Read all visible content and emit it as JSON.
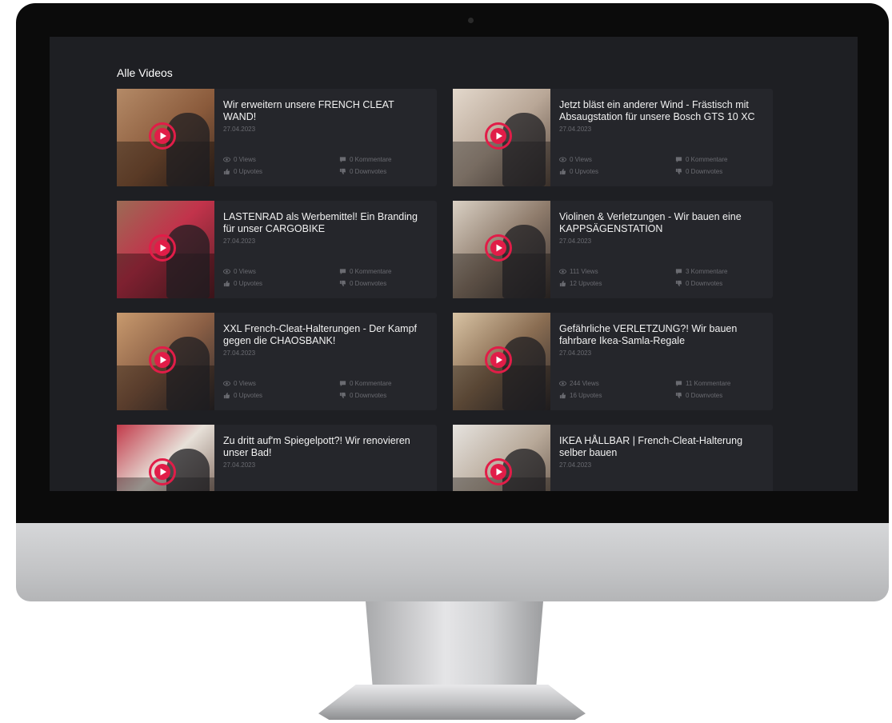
{
  "section_title": "Alle Videos",
  "colors": {
    "accent": "#e11d48",
    "screen_bg": "#1e1f23",
    "card_bg": "#25262b",
    "muted_text": "#6a6b71"
  },
  "icons": {
    "views": "eye-icon",
    "comments": "comment-icon",
    "upvotes": "thumbs-up-icon",
    "downvotes": "thumbs-down-icon",
    "play": "play-icon"
  },
  "videos": [
    {
      "title": "Wir erweitern unsere FRENCH CLEAT WAND!",
      "date": "27.04.2023",
      "views": "0 Views",
      "comments": "0 Kommentare",
      "upvotes": "0 Upvotes",
      "downvotes": "0 Downvotes"
    },
    {
      "title": "Jetzt bläst ein anderer Wind - Frästisch mit Absaugstation für unsere Bosch GTS 10 XC",
      "date": "27.04.2023",
      "views": "0 Views",
      "comments": "0 Kommentare",
      "upvotes": "0 Upvotes",
      "downvotes": "0 Downvotes"
    },
    {
      "title": "LASTENRAD als Werbemittel! Ein Branding für unser CARGOBIKE",
      "date": "27.04.2023",
      "views": "0 Views",
      "comments": "0 Kommentare",
      "upvotes": "0 Upvotes",
      "downvotes": "0 Downvotes"
    },
    {
      "title": "Violinen & Verletzungen - Wir bauen eine KAPPSÄGENSTATION",
      "date": "27.04.2023",
      "views": "111 Views",
      "comments": "3 Kommentare",
      "upvotes": "12 Upvotes",
      "downvotes": "0 Downvotes"
    },
    {
      "title": "XXL French-Cleat-Halterungen - Der Kampf gegen die CHAOSBANK!",
      "date": "27.04.2023",
      "views": "0 Views",
      "comments": "0 Kommentare",
      "upvotes": "0 Upvotes",
      "downvotes": "0 Downvotes"
    },
    {
      "title": "Gefährliche VERLETZUNG?! Wir bauen fahrbare Ikea-Samla-Regale",
      "date": "27.04.2023",
      "views": "244 Views",
      "comments": "11 Kommentare",
      "upvotes": "16 Upvotes",
      "downvotes": "0 Downvotes"
    },
    {
      "title": "Zu dritt auf'm Spiegelpott?! Wir renovieren unser Bad!",
      "date": "27.04.2023",
      "views": "",
      "comments": "",
      "upvotes": "",
      "downvotes": ""
    },
    {
      "title": "IKEA HÅLLBAR | French-Cleat-Halterung selber bauen",
      "date": "27.04.2023",
      "views": "",
      "comments": "",
      "upvotes": "",
      "downvotes": ""
    }
  ]
}
